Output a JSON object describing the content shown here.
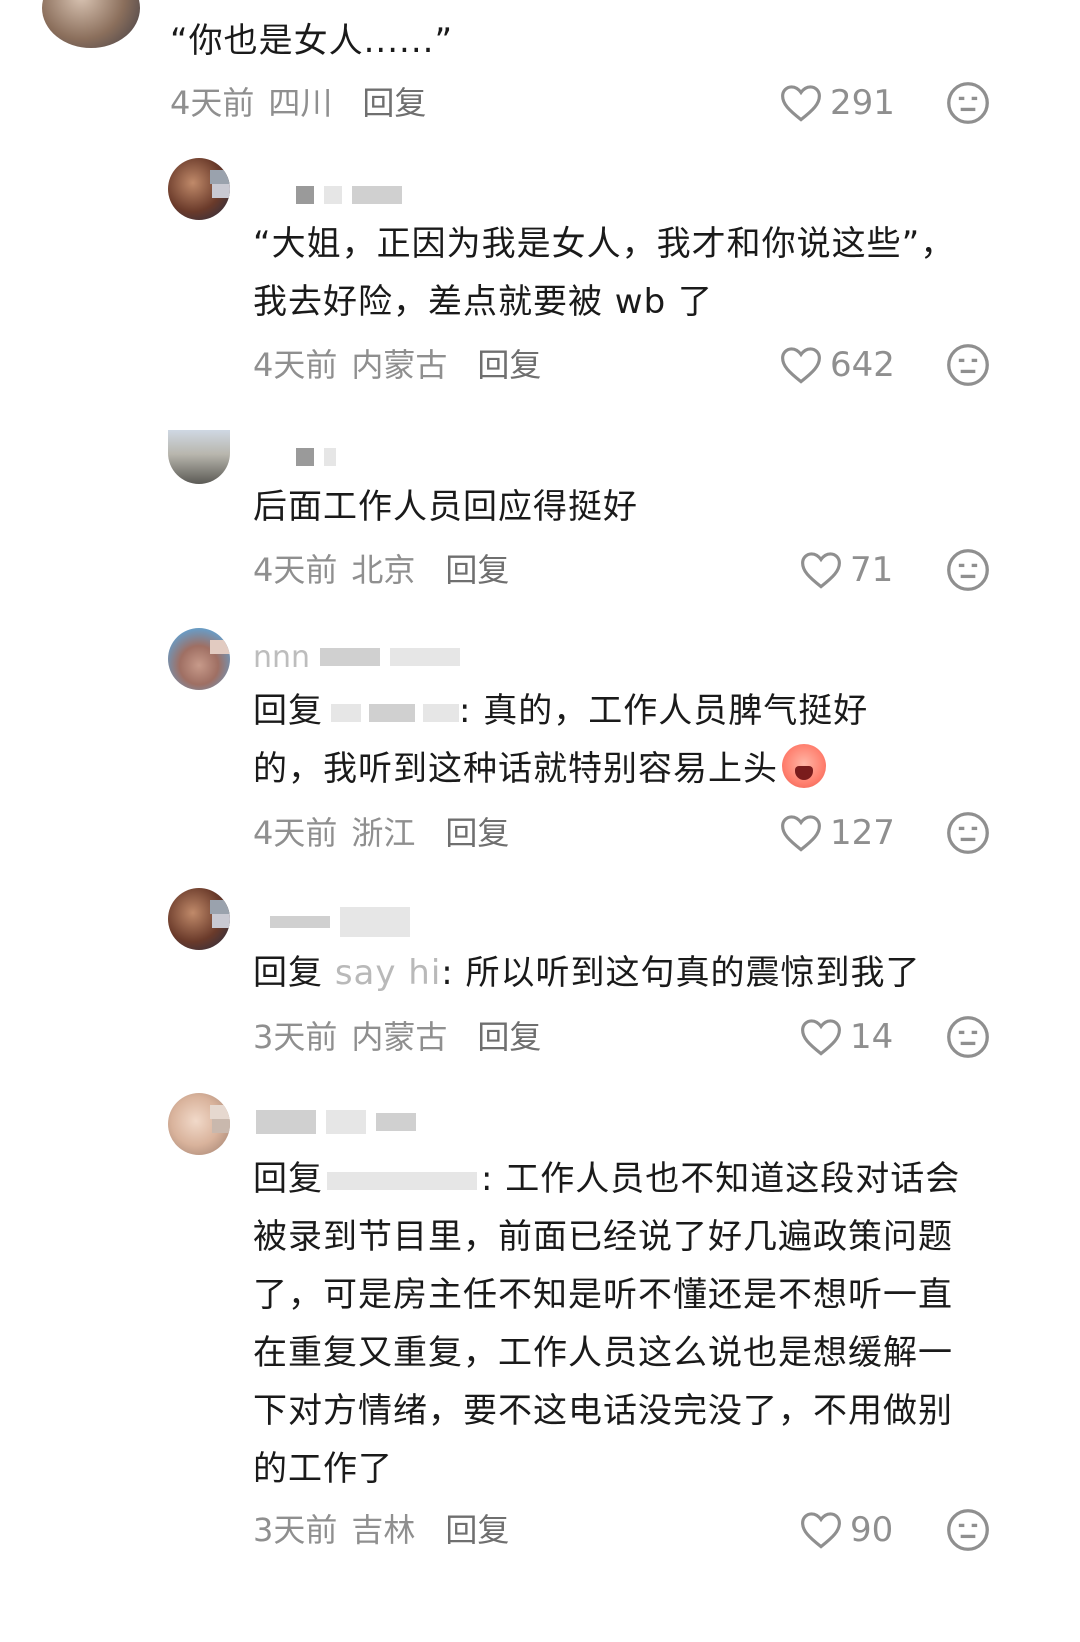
{
  "comments": [
    {
      "text": "“你也是女人......”",
      "time": "4天前",
      "location": "四川",
      "reply_label": "回复",
      "likes": "291"
    },
    {
      "text_line1": "“大姐，正因为我是女人，我才和你说这些”，",
      "text_line2": "我去好险，差点就要被 wb 了",
      "time": "4天前",
      "location": "内蒙古",
      "reply_label": "回复",
      "likes": "642"
    },
    {
      "text": "后面工作人员回应得挺好",
      "time": "4天前",
      "location": "北京",
      "reply_label": "回复",
      "likes": "71"
    },
    {
      "username_visible": "nnn",
      "reply_prefix": "回复",
      "text_line1_rest": ": 真的，工作人员脾气挺好",
      "text_line2": "的，我听到这种话就特别容易上头",
      "time": "4天前",
      "location": "浙江",
      "reply_label": "回复",
      "likes": "127"
    },
    {
      "reply_prefix": "回复",
      "reply_to": "say hi",
      "text_rest": ": 所以听到这句真的震惊到我了",
      "time": "3天前",
      "location": "内蒙古",
      "reply_label": "回复",
      "likes": "14"
    },
    {
      "reply_prefix": "回复",
      "text_line1_rest": ": 工作人员也不知道这段对话会",
      "text_line2": "被录到节目里，前面已经说了好几遍政策问题",
      "text_line3": "了，可是房主任不知是听不懂还是不想听一直",
      "text_line4": "在重复又重复，工作人员这么说也是想缓解一",
      "text_line5": "下对方情绪，要不这电话没完没了，不用做别",
      "text_line6": "的工作了",
      "time": "3天前",
      "location": "吉林",
      "reply_label": "回复",
      "likes": "90"
    }
  ],
  "colors": {
    "text": "#1a1a1a",
    "meta": "#8f8f8f",
    "muted_name": "#b9b9b9",
    "icon": "#8f8f8f"
  },
  "icons": [
    "heart-icon",
    "dislike-face-icon",
    "crying-emoji"
  ]
}
